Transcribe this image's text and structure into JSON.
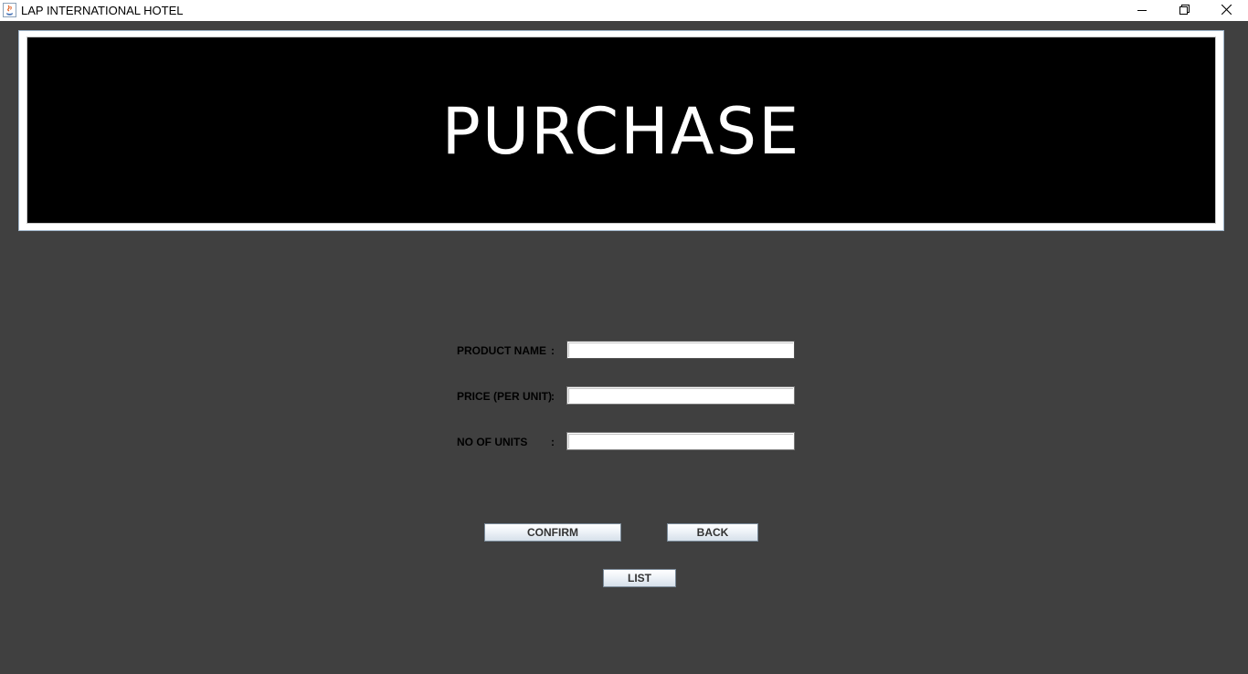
{
  "window": {
    "title": "LAP INTERNATIONAL HOTEL",
    "icon": "java-coffee-cup-icon"
  },
  "banner": {
    "heading": "PURCHASE"
  },
  "form": {
    "fields": [
      {
        "label": "PRODUCT NAME",
        "colon": ":",
        "value": ""
      },
      {
        "label": "PRICE (PER UNIT)",
        "colon": ":",
        "value": ""
      },
      {
        "label": "NO OF UNITS",
        "colon": ":",
        "value": ""
      }
    ]
  },
  "buttons": {
    "confirm": "CONFIRM",
    "back": "BACK",
    "list": "LIST"
  },
  "colors": {
    "background": "#404040",
    "banner": "#000000",
    "banner_text": "#ffffff"
  }
}
